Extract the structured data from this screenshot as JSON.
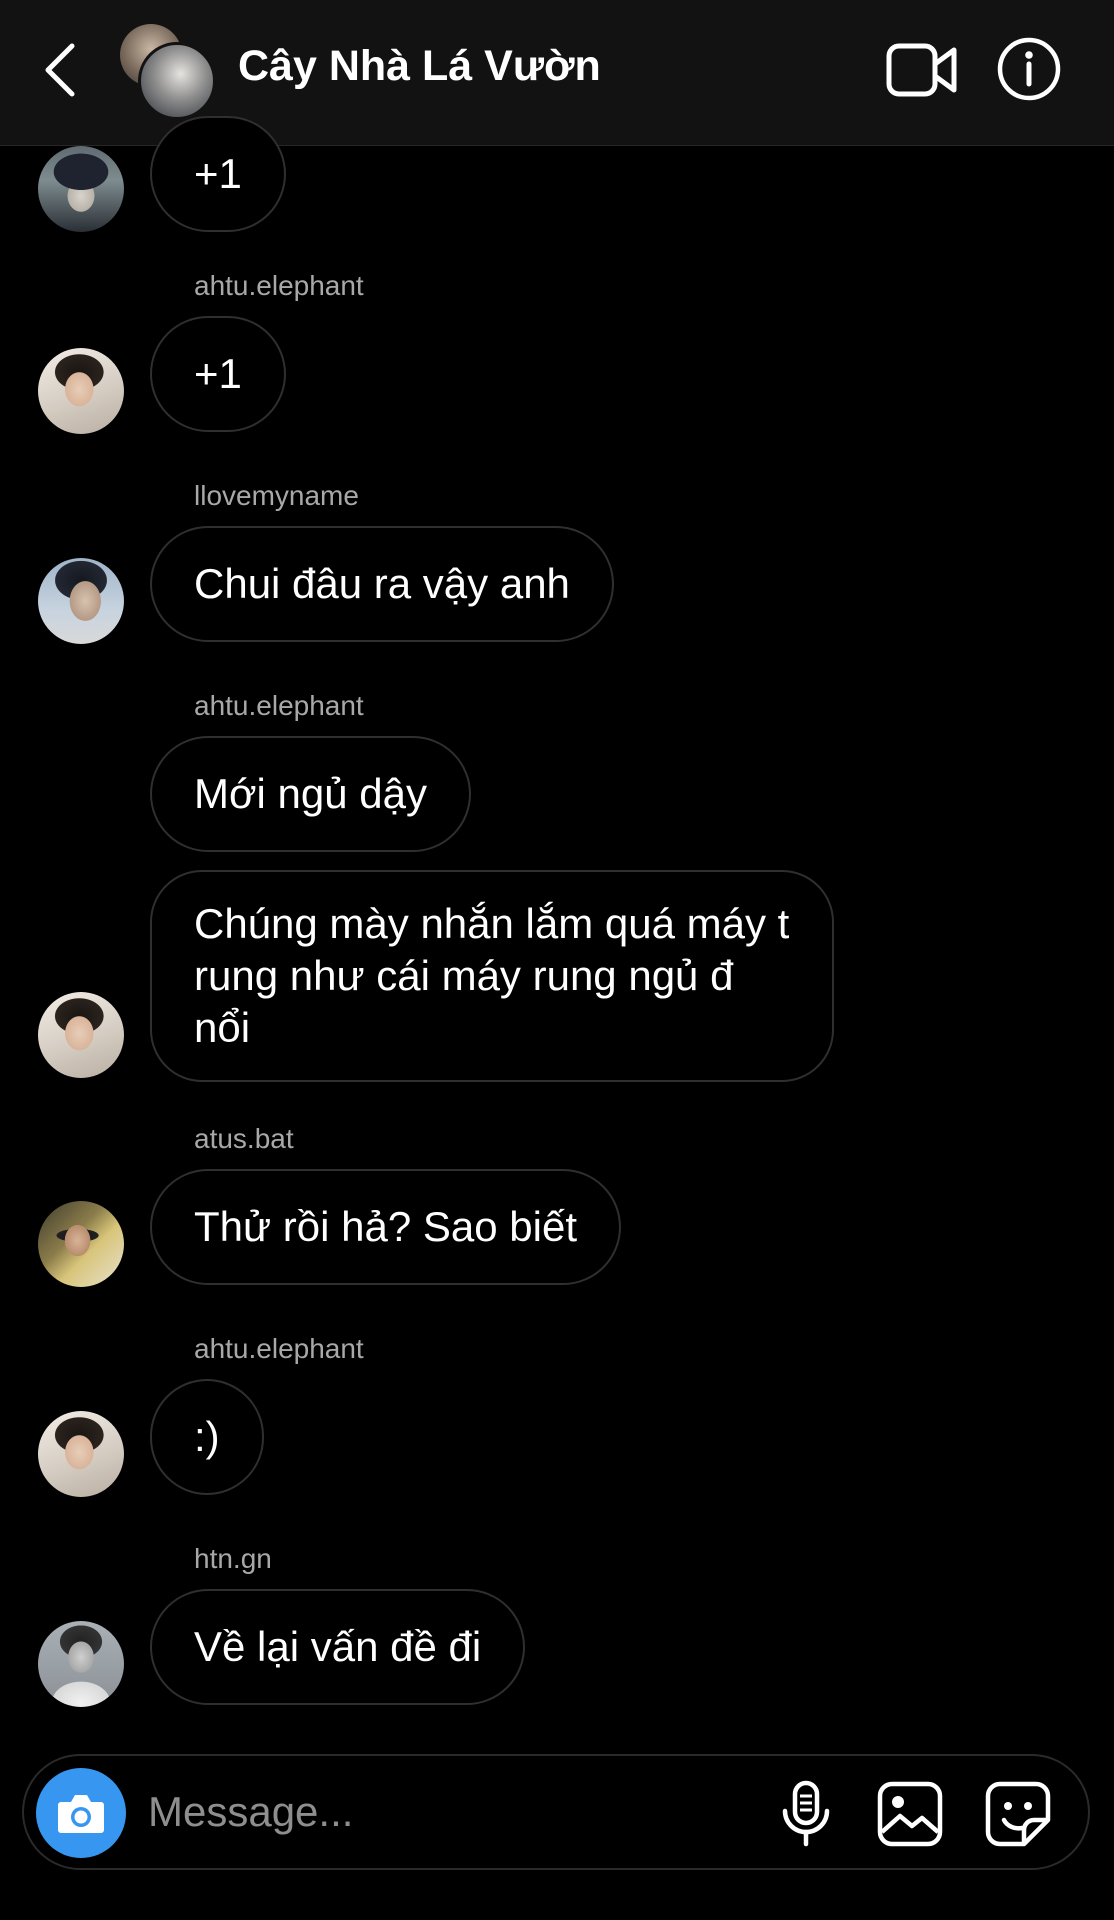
{
  "header": {
    "title": "Cây Nhà Lá Vườn",
    "icons": [
      "chevron-left-icon",
      "video-camera-icon",
      "info-icon"
    ]
  },
  "messages": [
    {
      "username": "",
      "text": "+1",
      "avatar": "cap"
    },
    {
      "username": "ahtu.elephant",
      "text": "+1",
      "avatar": "boy"
    },
    {
      "username": "llovemyname",
      "text": "Chui đâu ra vậy anh",
      "avatar": "side"
    },
    {
      "username": "ahtu.elephant",
      "text": "Mới ngủ dậy",
      "avatar": ""
    },
    {
      "username": "",
      "text": "Chúng mày nhắn lắm quá máy t rung như cái máy rung ngủ đ nổi",
      "avatar": "boy"
    },
    {
      "username": "atus.bat",
      "text": "Thử rồi hả? Sao biết",
      "avatar": "sun"
    },
    {
      "username": "ahtu.elephant",
      "text": ":)",
      "avatar": "boy"
    },
    {
      "username": "htn.gn",
      "text": "Về lại vấn đề đi",
      "avatar": "bw"
    }
  ],
  "composer": {
    "placeholder": "Message...",
    "icons": [
      "camera-icon",
      "microphone-icon",
      "gallery-icon",
      "sticker-icon"
    ]
  },
  "colors": {
    "background": "#000000",
    "header_bg": "#121212",
    "bubble_border": "#2f2f2f",
    "username": "#a8a8a8",
    "camera_button": "#3797f0"
  }
}
